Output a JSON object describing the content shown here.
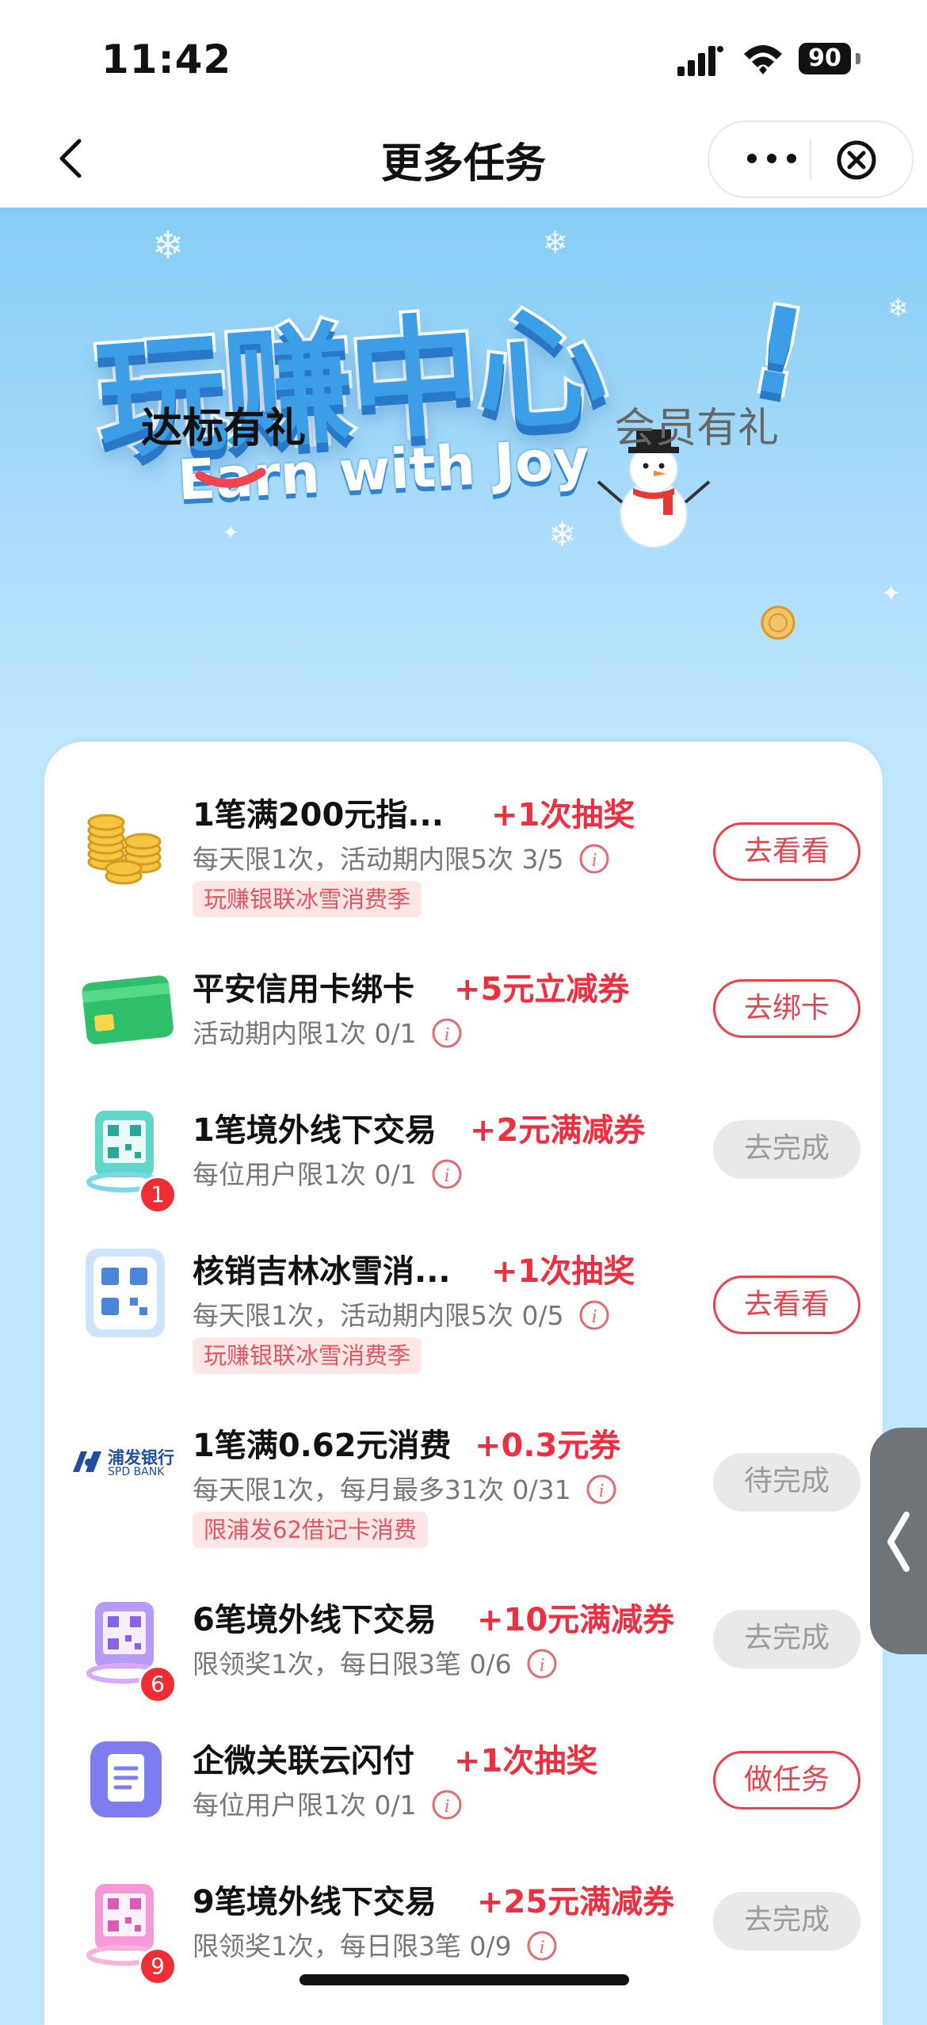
{
  "status": {
    "time": "11:42",
    "battery": "90"
  },
  "nav": {
    "title": "更多任务"
  },
  "hero": {
    "title": "玩赚中心",
    "exclaim": "!",
    "subtitle": "Earn with Joy"
  },
  "tabs": [
    {
      "label": "达标有礼",
      "active": true
    },
    {
      "label": "会员有礼",
      "active": false
    }
  ],
  "tasks": [
    {
      "title": "1笔满200元指...",
      "reward": "+1次抽奖",
      "sub": "每天限1次，活动期内限5次 3/5",
      "tag": "玩赚银联冰雪消费季",
      "button": "去看看",
      "button_style": "red",
      "icon": "gold-coins-icon"
    },
    {
      "title": "平安信用卡绑卡",
      "reward": "+5元立减券",
      "sub": "活动期内限1次 0/1",
      "tag": "",
      "button": "去绑卡",
      "button_style": "red",
      "icon": "credit-card-icon"
    },
    {
      "title": "1笔境外线下交易",
      "reward": "+2元满减券",
      "sub": "每位用户限1次 0/1",
      "tag": "",
      "button": "去完成",
      "button_style": "gray",
      "icon": "qr-code-icon",
      "badge": "1"
    },
    {
      "title": "核销吉林冰雪消...",
      "reward": "+1次抽奖",
      "sub": "每天限1次，活动期内限5次 0/5",
      "tag": "玩赚银联冰雪消费季",
      "button": "去看看",
      "button_style": "red",
      "icon": "scan-code-icon"
    },
    {
      "title": "1笔满0.62元消费",
      "reward": "+0.3元券",
      "sub": "每天限1次，每月最多31次 0/31",
      "tag": "限浦发62借记卡消费",
      "button": "待完成",
      "button_style": "gray",
      "icon": "spd-bank-logo",
      "logo_cn": "浦发银行",
      "logo_en": "SPD BANK"
    },
    {
      "title": "6笔境外线下交易",
      "reward": "+10元满减券",
      "sub": "限领奖1次，每日限3笔 0/6",
      "tag": "",
      "button": "去完成",
      "button_style": "gray",
      "icon": "qr-code-purple-icon",
      "badge": "6"
    },
    {
      "title": "企微关联云闪付",
      "reward": "+1次抽奖",
      "sub": "每位用户限1次 0/1",
      "tag": "",
      "button": "做任务",
      "button_style": "red",
      "icon": "document-icon"
    },
    {
      "title": "9笔境外线下交易",
      "reward": "+25元满减券",
      "sub": "限领奖1次，每日限3笔 0/9",
      "tag": "",
      "button": "去完成",
      "button_style": "gray",
      "icon": "qr-code-pink-icon",
      "badge": "9"
    }
  ],
  "colors": {
    "accent": "#ef2f3f",
    "hero_blue": "#86cdf6"
  }
}
